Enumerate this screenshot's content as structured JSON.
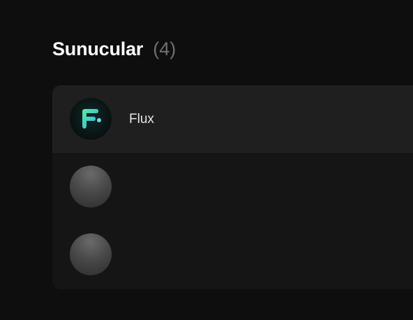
{
  "section": {
    "title": "Sunucular",
    "count": "(4)"
  },
  "providers": [
    {
      "name": "Flux",
      "icon": "flux-logo-icon",
      "selected": true
    },
    {
      "name": "",
      "icon": "placeholder-avatar-icon",
      "selected": false
    },
    {
      "name": "",
      "icon": "placeholder-avatar-icon",
      "selected": false
    }
  ],
  "colors": {
    "background": "#0e0e0e",
    "card": "#151515",
    "selected_row": "#1f1f1f",
    "flux_gradient_start": "#5ee6a6",
    "flux_gradient_end": "#29b6e6"
  }
}
